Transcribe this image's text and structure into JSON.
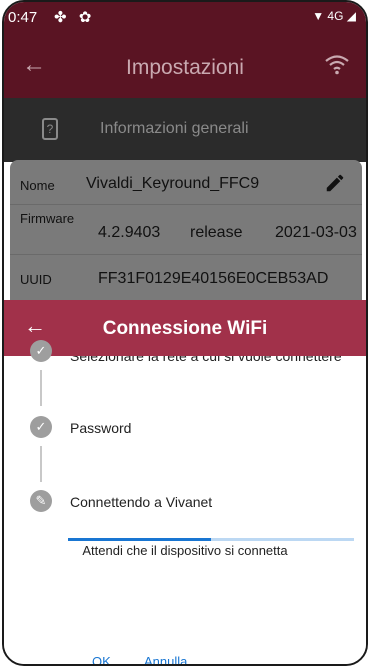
{
  "status_bar": {
    "time": "0:47",
    "network": "4G"
  },
  "app_bar": {
    "title": "Impostazioni"
  },
  "section": {
    "label": "Informazioni generali"
  },
  "device": {
    "name_label": "Nome",
    "name_value": "Vivaldi_Keyround_FFC9",
    "firmware_label": "Firmware",
    "firmware_version": "4.2.9403",
    "firmware_channel": "release",
    "firmware_date": "2021-03-03",
    "uuid_label": "UUID",
    "uuid_value": "FF31F0129E40156E0CEB53AD"
  },
  "dialog": {
    "title": "Connessione WiFi",
    "steps": [
      {
        "label": "Selezionare la rete a cui si vuole connettere",
        "state": "done"
      },
      {
        "label": "Password",
        "state": "done"
      },
      {
        "label": "Connettendo a  Vivanet",
        "state": "active"
      }
    ],
    "progress": 0.5,
    "wait_text": "Attendi che il dispositivo si connetta",
    "ok_label": "OK",
    "cancel_label": "Annulla"
  },
  "colors": {
    "appbar": "#5a1423",
    "dialog_header": "#a1314a",
    "accent": "#1976d2"
  }
}
